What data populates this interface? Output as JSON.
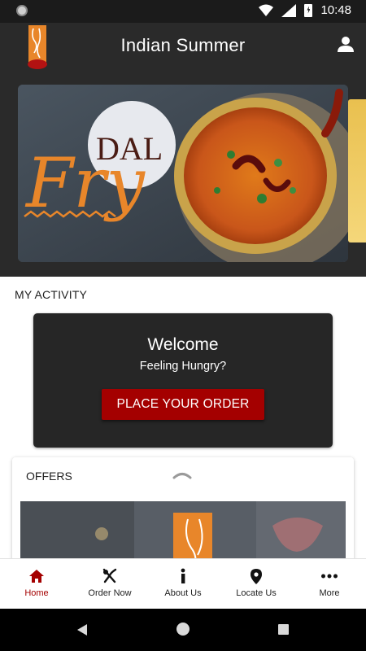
{
  "status_bar": {
    "time": "10:48"
  },
  "app_bar": {
    "title": "Indian Summer"
  },
  "banner": {
    "headline_top": "DAL",
    "headline_main": "Fry"
  },
  "activity": {
    "section_title": "MY ACTIVITY",
    "welcome_title": "Welcome",
    "welcome_subtitle": "Feeling Hungry?",
    "order_button_label": "PLACE YOUR ORDER"
  },
  "offers": {
    "title": "OFFERS"
  },
  "bottom_nav": {
    "items": [
      {
        "label": "Home",
        "icon": "home-icon",
        "active": true
      },
      {
        "label": "Order Now",
        "icon": "cutlery-icon",
        "active": false
      },
      {
        "label": "About Us",
        "icon": "info-icon",
        "active": false
      },
      {
        "label": "Locate Us",
        "icon": "location-pin-icon",
        "active": false
      },
      {
        "label": "More",
        "icon": "more-dots-icon",
        "active": false
      }
    ]
  },
  "colors": {
    "accent": "#a40000",
    "app_bar": "#2a2a2a",
    "card_dark": "#262626"
  }
}
